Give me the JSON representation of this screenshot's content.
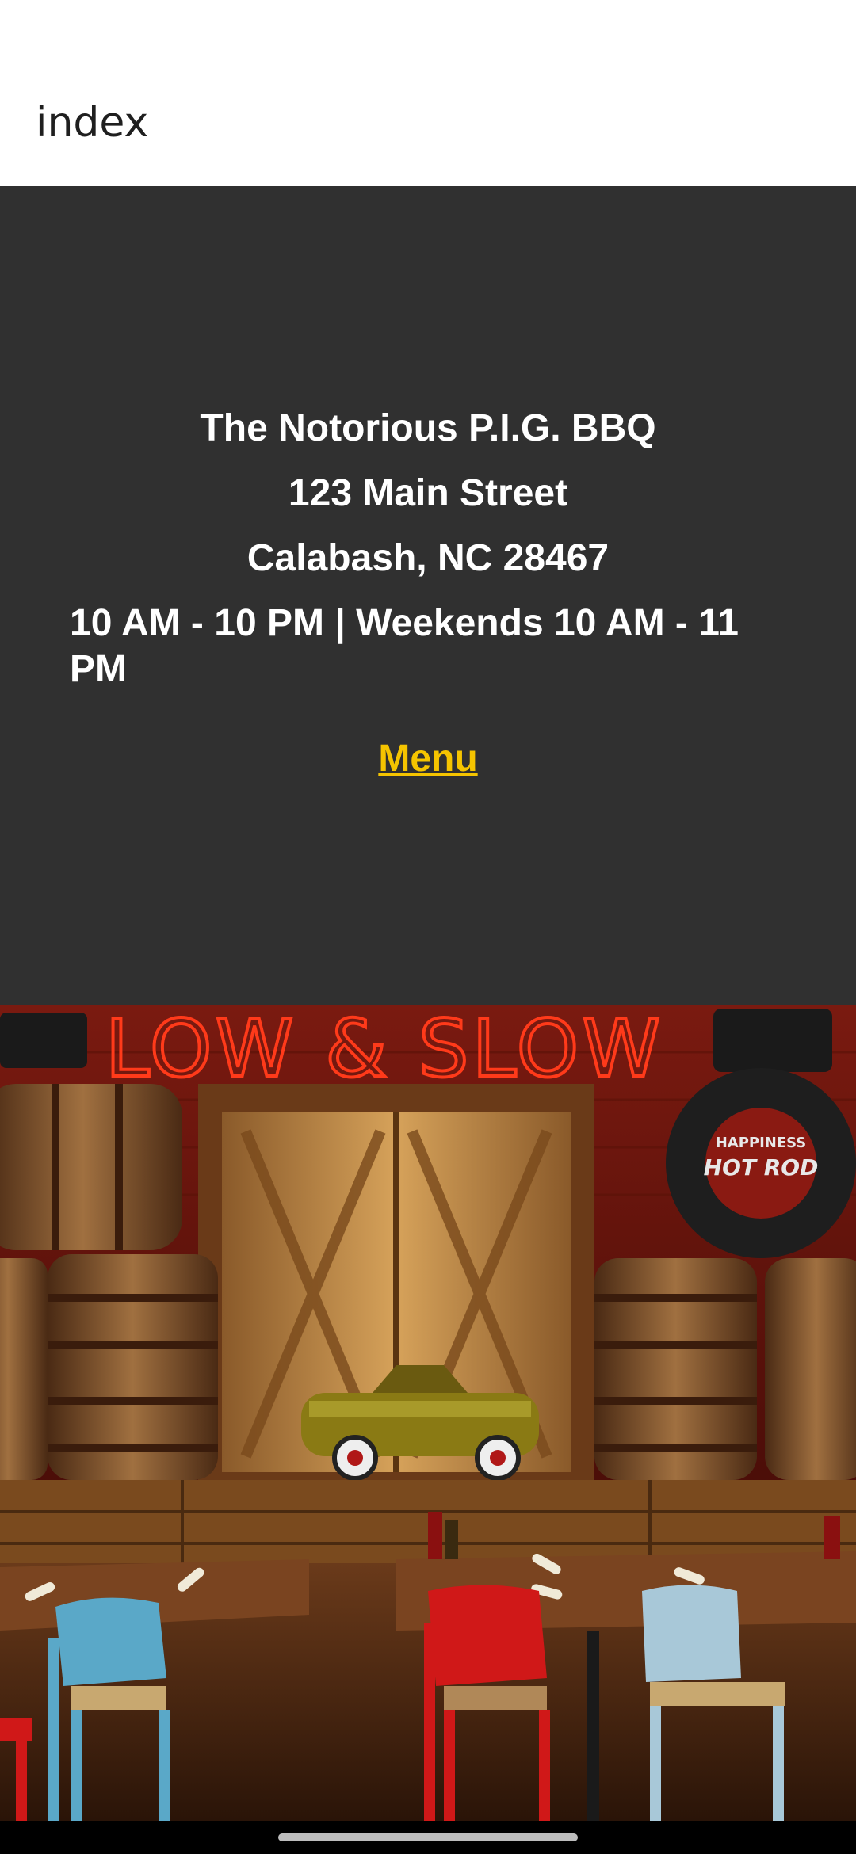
{
  "app_bar": {
    "title": "index"
  },
  "info": {
    "restaurant_name": "The Notorious P.I.G. BBQ",
    "street": "123 Main Street",
    "city_state_zip": "Calabash, NC 28467",
    "hours": "10 AM - 10 PM | Weekends 10 AM - 11 PM",
    "menu_link": "Menu"
  },
  "photo": {
    "neon_sign": "LOW & SLOW",
    "tire_text_1": "HAPPINESS",
    "tire_text_2": "HOT ROD"
  },
  "colors": {
    "app_bar_bg": "#ffffff",
    "info_bg": "#303030",
    "link": "#f5c400",
    "neon_red": "#ff2a1a"
  }
}
